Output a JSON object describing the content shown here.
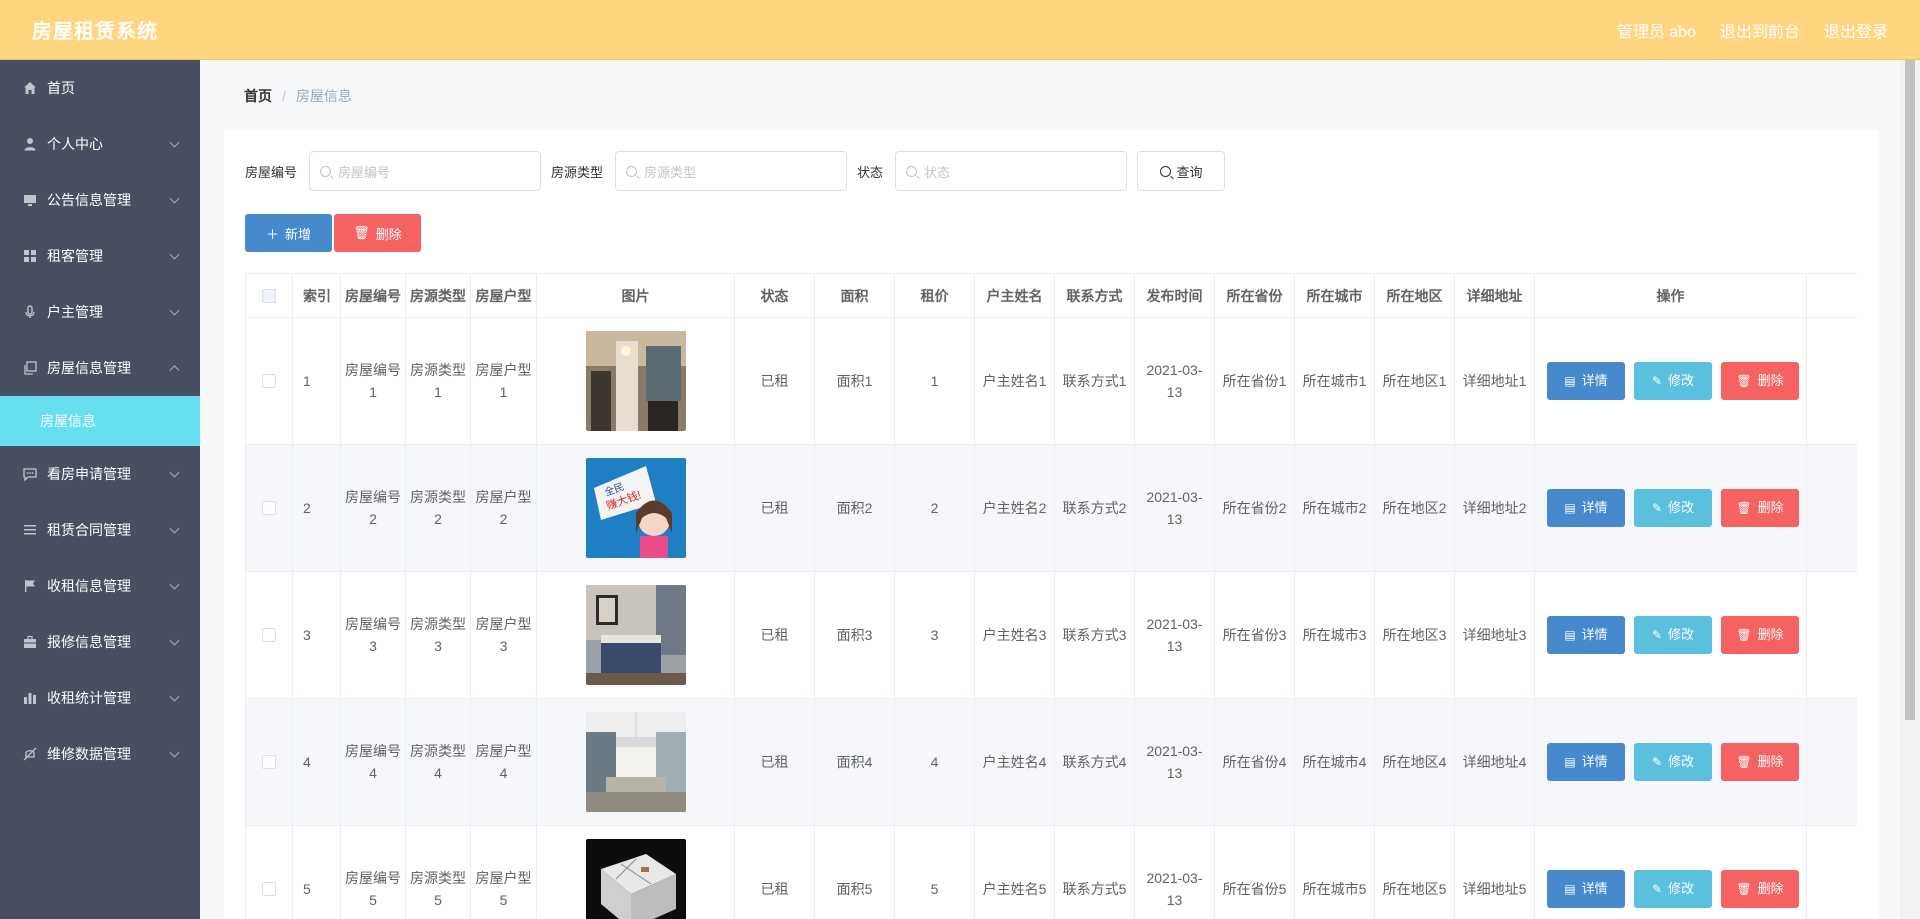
{
  "header": {
    "title": "房屋租赁系统",
    "user": "管理员 abo",
    "to_front": "退出到前台",
    "logout": "退出登录",
    "background_color": "#ffd67f"
  },
  "sidebar": {
    "items": [
      {
        "label": "首页",
        "icon": "home-icon",
        "arrow": false
      },
      {
        "label": "个人中心",
        "icon": "user-icon",
        "arrow": true
      },
      {
        "label": "公告信息管理",
        "icon": "monitor-icon",
        "arrow": true
      },
      {
        "label": "租客管理",
        "icon": "grid-icon",
        "arrow": true
      },
      {
        "label": "户主管理",
        "icon": "microphone-icon",
        "arrow": true
      },
      {
        "label": "房屋信息管理",
        "icon": "copy-icon",
        "arrow": true,
        "expanded": true
      },
      {
        "label": "看房申请管理",
        "icon": "chat-icon",
        "arrow": true
      },
      {
        "label": "租赁合同管理",
        "icon": "list-icon",
        "arrow": true
      },
      {
        "label": "收租信息管理",
        "icon": "flag-icon",
        "arrow": true
      },
      {
        "label": "报修信息管理",
        "icon": "toolbox-icon",
        "arrow": true
      },
      {
        "label": "收租统计管理",
        "icon": "chart-icon",
        "arrow": true
      },
      {
        "label": "维修数据管理",
        "icon": "no-bell-icon",
        "arrow": true
      }
    ],
    "active_sub": "房屋信息",
    "background_color": "#474f61",
    "active_color": "#66e0f1"
  },
  "breadcrumb": {
    "home": "首页",
    "separator": "/",
    "current": "房屋信息"
  },
  "search": {
    "label1": "房屋编号",
    "placeholder1": "房屋编号",
    "label2": "房源类型",
    "placeholder2": "房源类型",
    "label3": "状态",
    "placeholder3": "状态",
    "button": "查询"
  },
  "toolbar": {
    "add": "新增",
    "delete": "删除"
  },
  "table": {
    "headers": [
      "索引",
      "房屋编号",
      "房源类型",
      "房屋户型",
      "图片",
      "状态",
      "面积",
      "租价",
      "户主姓名",
      "联系方式",
      "发布时间",
      "所在省份",
      "所在城市",
      "所在地区",
      "详细地址",
      "操作"
    ],
    "rows": [
      {
        "index": "1",
        "code": "房屋编号1",
        "type": "房源类型1",
        "layout": "房屋户型1",
        "image": "interior-photo",
        "status": "已租",
        "area": "面积1",
        "price": "1",
        "owner": "户主姓名1",
        "contact": "联系方式1",
        "date": "2021-03-13",
        "province": "所在省份1",
        "city": "所在城市1",
        "district": "所在地区1",
        "address": "详细地址1"
      },
      {
        "index": "2",
        "code": "房屋编号2",
        "type": "房源类型2",
        "layout": "房屋户型2",
        "image": "cartoon-photo",
        "status": "已租",
        "area": "面积2",
        "price": "2",
        "owner": "户主姓名2",
        "contact": "联系方式2",
        "date": "2021-03-13",
        "province": "所在省份2",
        "city": "所在城市2",
        "district": "所在地区2",
        "address": "详细地址2"
      },
      {
        "index": "3",
        "code": "房屋编号3",
        "type": "房源类型3",
        "layout": "房屋户型3",
        "image": "bedroom-photo",
        "status": "已租",
        "area": "面积3",
        "price": "3",
        "owner": "户主姓名3",
        "contact": "联系方式3",
        "date": "2021-03-13",
        "province": "所在省份3",
        "city": "所在城市3",
        "district": "所在地区3",
        "address": "详细地址3"
      },
      {
        "index": "4",
        "code": "房屋编号4",
        "type": "房源类型4",
        "layout": "房屋户型4",
        "image": "livingroom-photo",
        "status": "已租",
        "area": "面积4",
        "price": "4",
        "owner": "户主姓名4",
        "contact": "联系方式4",
        "date": "2021-03-13",
        "province": "所在省份4",
        "city": "所在城市4",
        "district": "所在地区4",
        "address": "详细地址4"
      },
      {
        "index": "5",
        "code": "房屋编号5",
        "type": "房源类型5",
        "layout": "房屋户型5",
        "image": "floorplan-photo",
        "status": "已租",
        "area": "面积5",
        "price": "5",
        "owner": "户主姓名5",
        "contact": "联系方式5",
        "date": "2021-03-13",
        "province": "所在省份5",
        "city": "所在城市5",
        "district": "所在地区5",
        "address": "详细地址5"
      }
    ],
    "actions": {
      "detail": "详情",
      "edit": "修改",
      "delete": "删除"
    }
  }
}
